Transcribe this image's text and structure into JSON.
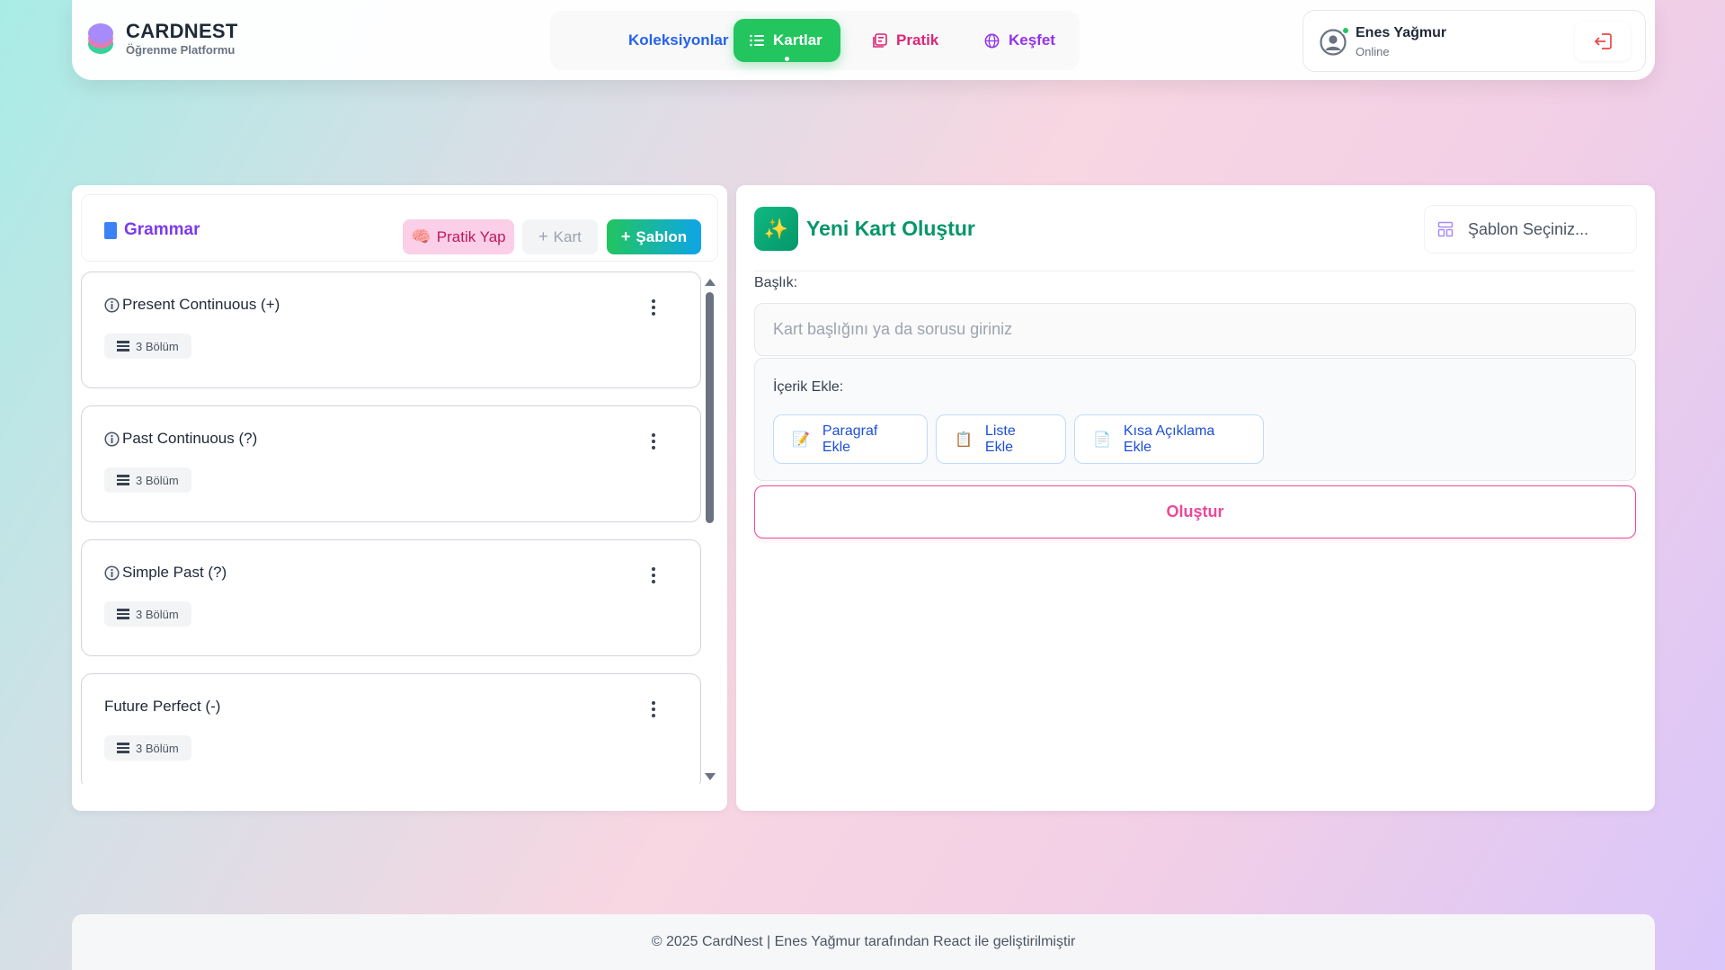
{
  "brand": {
    "name": "CARDNEST",
    "subtitle": "Öğrenme Platformu"
  },
  "nav": {
    "items": [
      {
        "label": "Koleksiyonlar",
        "active": false
      },
      {
        "label": "Kartlar",
        "active": true,
        "icon": "list-icon"
      },
      {
        "label": "Pratik",
        "active": false,
        "icon": "practice-icon"
      },
      {
        "label": "Keşfet",
        "active": false,
        "icon": "globe-icon"
      }
    ]
  },
  "user": {
    "name": "Enes Yağmur",
    "status": "Online"
  },
  "collection": {
    "title": "Grammar",
    "buttons": {
      "practice": "Pratik Yap",
      "card": "Kart",
      "template": "Şablon"
    },
    "cards": [
      {
        "title": "Present Continuous (+)",
        "sections": "3 Bölüm",
        "has_info_icon": true
      },
      {
        "title": "Past Continuous (?)",
        "sections": "3 Bölüm",
        "has_info_icon": true
      },
      {
        "title": "Simple Past (?)",
        "sections": "3 Bölüm",
        "has_info_icon": true
      },
      {
        "title": "Future Perfect (-)",
        "sections": "3 Bölüm",
        "has_info_icon": false
      }
    ]
  },
  "editor": {
    "title": "Yeni Kart Oluştur",
    "template_placeholder": "Şablon Seçiniz...",
    "title_label": "Başlık:",
    "title_placeholder": "Kart başlığını ya da sorusu giriniz",
    "title_value": "",
    "content_label": "İçerik Ekle:",
    "content_buttons": {
      "paragraph": "Paragraf Ekle",
      "list": "Liste Ekle",
      "short": "Kısa Açıklama Ekle"
    },
    "submit": "Oluştur"
  },
  "footer": {
    "text": "© 2025 CardNest | Enes Yağmur tarafından React ile geliştirilmiştir"
  },
  "colors": {
    "accent_green": "#22c55e",
    "accent_pink": "#ec4899",
    "accent_purple": "#7c3aed",
    "accent_blue": "#2563eb"
  }
}
